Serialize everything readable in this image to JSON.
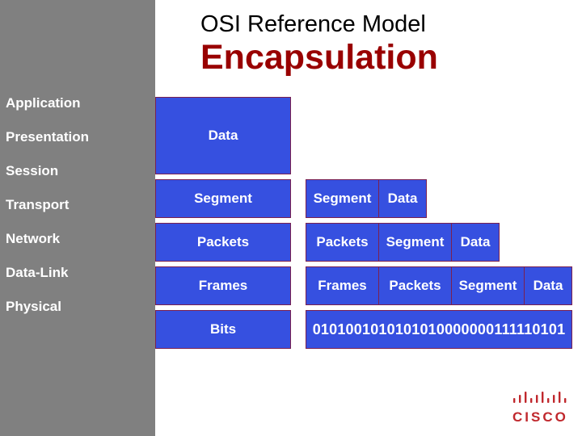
{
  "header": {
    "title": "OSI Reference Model",
    "subtitle": "Encapsulation"
  },
  "layers": [
    "Application",
    "Presentation",
    "Session",
    "Transport",
    "Network",
    "Data-Link",
    "Physical"
  ],
  "pdu_names": {
    "data": "Data",
    "segment": "Segment",
    "packets": "Packets",
    "frames": "Frames",
    "bits": "Bits"
  },
  "encapsulation_rows": {
    "transport": [
      "Segment",
      "Data"
    ],
    "network": [
      "Packets",
      "Segment",
      "Data"
    ],
    "datalink": [
      "Frames",
      "Packets",
      "Segment",
      "Data"
    ],
    "physical": "0101001010101010000000111110101"
  },
  "logo": {
    "text": "CISCO",
    "color": "#c0282d"
  },
  "colors": {
    "sidebar": "#808080",
    "box_fill": "#3650e0",
    "box_border": "#7a2050",
    "subtitle": "#990000"
  }
}
